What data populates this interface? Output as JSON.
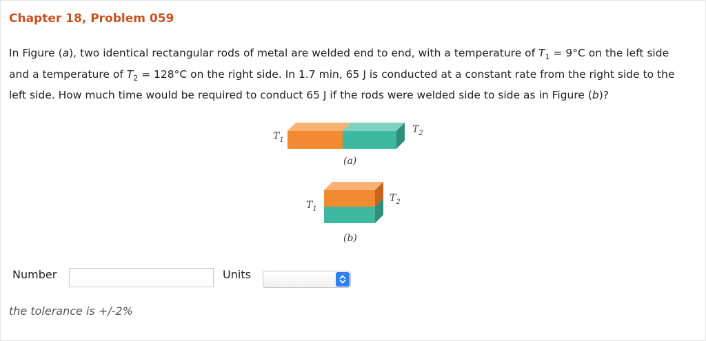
{
  "header": {
    "title": "Chapter 18, Problem 059"
  },
  "problem": {
    "p1": "In Figure (",
    "fig_a": "a",
    "p2": "), two identical rectangular rods of metal are welded end to end, with a temperature of ",
    "t1_symbol": "T",
    "t1_sub": "1",
    "t1_value": " = 9°C on the left side and a temperature of ",
    "t2_symbol": "T",
    "t2_sub": "2",
    "t2_value": " = 128°C on the right side. In 1.7 min, 65 J is conducted at a constant rate from the right side to the left side. How much time would be required to conduct 65 J if the rods were welded side to side as in Figure (",
    "fig_b": "b",
    "p3": ")?"
  },
  "figure": {
    "a_left_label": "T",
    "a_left_sub": "1",
    "a_right_label": "T",
    "a_right_sub": "2",
    "a_caption": "(a)",
    "b_left_label": "T",
    "b_left_sub": "1",
    "b_right_label": "T",
    "b_right_sub": "2",
    "b_caption": "(b)",
    "colors": {
      "orange": "#f28a32",
      "teal": "#3eb8a0"
    }
  },
  "answer": {
    "number_label": "Number",
    "number_value": "",
    "units_label": "Units",
    "units_selected": "",
    "select_icon": "chevron-up-down-icon",
    "tolerance": "the tolerance is +/-2%"
  }
}
